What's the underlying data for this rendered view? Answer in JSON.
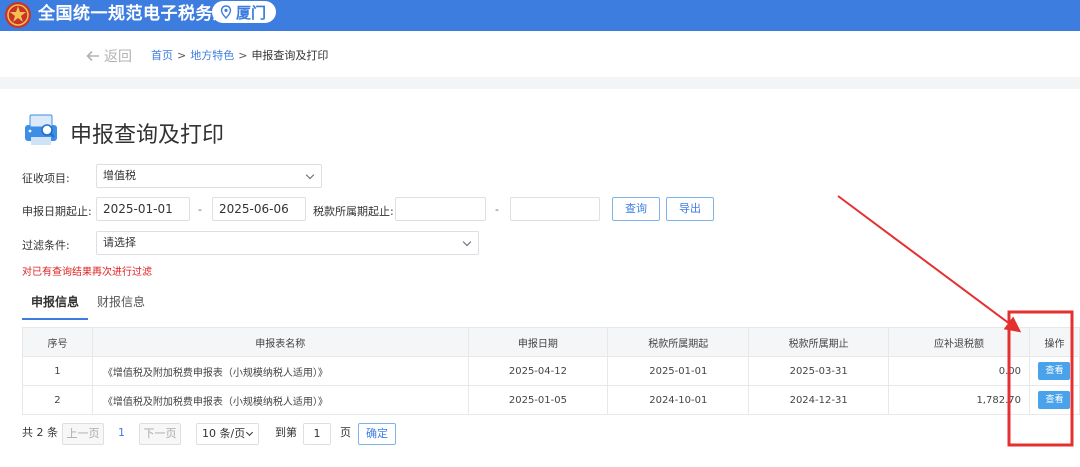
{
  "header": {
    "site_title": "全国统一规范电子税务局",
    "city": "厦门"
  },
  "breadcrumb": {
    "back_label": "返回",
    "items": [
      "首页",
      "地方特色",
      "申报查询及打印"
    ],
    "sep": ">"
  },
  "page_title": "申报查询及打印",
  "filters": {
    "levy_item_label": "征收项目:",
    "levy_item_value": "增值税",
    "date_range_label": "申报日期起止:",
    "date_from": "2025-01-01",
    "date_to": "2025-06-06",
    "range_dash": "-",
    "period_label": "税款所属期起止:",
    "period_from": "",
    "period_to": "",
    "query_label": "查询",
    "export_label": "导出",
    "filter_label": "过滤条件:",
    "filter_value": "请选择",
    "hint": "对已有查询结果再次进行过滤"
  },
  "tabs": [
    {
      "label": "申报信息",
      "active": true
    },
    {
      "label": "财报信息",
      "active": false
    }
  ],
  "table": {
    "columns": [
      "序号",
      "申报表名称",
      "申报日期",
      "税款所属期起",
      "税款所属期止",
      "应补退税额",
      "操作"
    ],
    "rows": [
      {
        "index": "1",
        "name": "《增值税及附加税费申报表（小规模纳税人适用）》",
        "date": "2025-04-12",
        "period_from": "2025-01-01",
        "period_to": "2025-03-31",
        "amount": "0.00",
        "action": "查看"
      },
      {
        "index": "2",
        "name": "《增值税及附加税费申报表（小规模纳税人适用）》",
        "date": "2025-01-05",
        "period_from": "2024-10-01",
        "period_to": "2024-12-31",
        "amount": "1,782.70",
        "action": "查看"
      }
    ]
  },
  "pager": {
    "total": "共 2 条",
    "prev": "上一页",
    "current": "1",
    "next": "下一页",
    "page_size": "10 条/页",
    "goto_label": "到第",
    "goto_value": "1",
    "page_unit": "页",
    "confirm": "确定"
  },
  "colors": {
    "brand": "#3e7de0",
    "view_button": "#4aa3ea",
    "annotation": "#e53030",
    "hint": "#e02020"
  }
}
